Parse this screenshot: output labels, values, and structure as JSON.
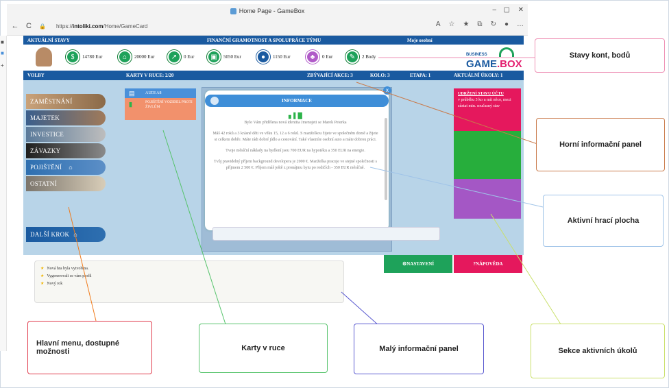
{
  "browser": {
    "tab_title": "Home Page - GameBox",
    "url_prefix": "https://",
    "url_domain": "intoliki.com",
    "url_path": "/Home/GameCard",
    "minimize": "–",
    "maximize": "▢",
    "close": "✕",
    "back": "←",
    "reload": "C"
  },
  "game": {
    "top_bar": {
      "current_state": "AKTUÁLNÍ STAVY",
      "title": "FINANČNÍ GRAMOTNOST A SPOLUPRÁCE TÝMU",
      "my_settings": "Moje osobní"
    },
    "stats": [
      {
        "value": "14780 Eur",
        "color": "#1ea25a",
        "icon": "money-icon"
      },
      {
        "value": "20000 Eur",
        "color": "#1ea25a",
        "icon": "house-icon"
      },
      {
        "value": "0 Eur",
        "color": "#1ea25a",
        "icon": "growth-icon"
      },
      {
        "value": "5050 Eur",
        "color": "#1ea25a",
        "icon": "wallet-icon"
      },
      {
        "value": "1150 Eur",
        "color": "#1a5aa0",
        "icon": "coins-icon"
      },
      {
        "value": "0 Eur",
        "color": "#b05ac8",
        "icon": "piggy-icon"
      },
      {
        "value": "2 Body",
        "color": "#1ea25a",
        "icon": "points-icon"
      }
    ],
    "logo": {
      "small": "BUSINESS",
      "big_a": "GAME",
      "big_b": ".BOX"
    },
    "second_bar": {
      "volby": "VOLBY",
      "cards_in_hand": "KARTY V RUCE: 2/20",
      "remaining_actions": "ZBÝVAJÍCÍ AKCE: 3",
      "round": "KOLO: 3",
      "stage": "ETAPA: 1",
      "current_tasks": "AKTUÁLNÍ ÚKOLY: 1"
    },
    "menu": [
      {
        "label": "ZAMĚSTNÁNÍ",
        "color": "#b8845a"
      },
      {
        "label": "MAJETEK",
        "color": "#3b5f8c"
      },
      {
        "label": "INVESTICE",
        "color": "#5a7a9a"
      },
      {
        "label": "ZÁVAZKY",
        "color": "#2a2a2a"
      },
      {
        "label": "POJIŠTĚNÍ",
        "color": "#2e6fb0"
      },
      {
        "label": "OSTATNÍ",
        "color": "#8a7e70"
      }
    ],
    "next_step": "DALŠÍ KROK",
    "cards": [
      {
        "label": "AUDI A8"
      },
      {
        "label": "POJIŠTĚNÍ VOZIDEL PROTI ŽIVLŮM"
      }
    ],
    "modal": {
      "title": "INFORMACE",
      "close": "x",
      "p1": "Bylo Vám přidělena nová identita Jmenujeti se Marek Peterka",
      "p2": "Máš 42 roků a 3 krásné děti ve věku 15, 12 a 6 roků. S manželkou žijete ve společném domě a žijete si celkem dobře. Máte rádi dobré jídlo a cestování. Také vlastníte osobní auto a máte dobrou práci.",
      "p3": "Tvoje měsíční náklady na bydlení jsou 700 EUR na hypotéku a 350 EUR na energie.",
      "p4": "Tvůj pravidelný příjem background developera je 2000 €. Manželka pracuje ve stejné společnosti s příjmem 2 500 €. Příjem máš ještě z pronájmu bytu po rodičích - 350 EUR měsíčně."
    },
    "task": {
      "title": "UDRŽENÍ STAVU ÚČTU",
      "text": "v průběhu 3 ko u mít něco, mezi zůstat min. současný stav"
    },
    "buttons": {
      "settings": "NASTAVENÍ",
      "help": "NÁPOVĚDA",
      "settings_color": "#1ea25a",
      "help_color": "#e5185d"
    },
    "small_panel": [
      "Nová hra byla vytvořena.",
      "Vygenerovali se vám profil",
      "Nový rok"
    ]
  },
  "annotations": {
    "stavy": "Stavy kont, bodů",
    "horni": "Horní informační panel",
    "aktivni": "Aktivní hrací plocha",
    "menu": "Hlavní menu, dostupné možnosti",
    "karty": "Karty v ruce",
    "maly": "Malý informační panel",
    "ukoly": "Sekce aktivních úkolů"
  }
}
